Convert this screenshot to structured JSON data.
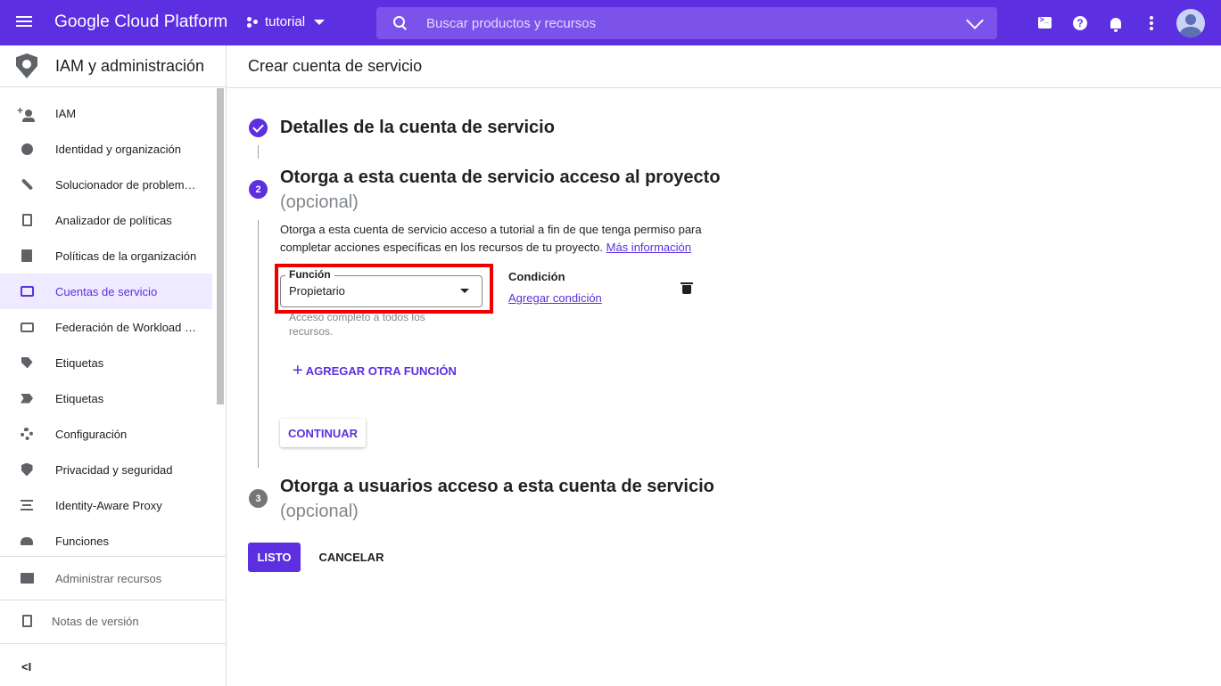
{
  "topbar": {
    "brand": "Google Cloud Platform",
    "project": "tutorial",
    "search_placeholder": "Buscar productos y recursos",
    "accent_color": "#5c2fe0",
    "icons": [
      "menu-icon",
      "project-icon",
      "search-icon",
      "chevron-down-icon",
      "cloud-shell-icon",
      "help-icon",
      "notifications-icon",
      "more-vert-icon",
      "account-avatar"
    ]
  },
  "sidebar": {
    "title": "IAM y administración",
    "items": [
      {
        "label": "IAM",
        "icon": "person-add-icon"
      },
      {
        "label": "Identidad y organización",
        "icon": "account-circle-icon"
      },
      {
        "label": "Solucionador de problem…",
        "icon": "wrench-icon"
      },
      {
        "label": "Analizador de políticas",
        "icon": "policy-doc-icon"
      },
      {
        "label": "Políticas de la organización",
        "icon": "list-doc-icon"
      },
      {
        "label": "Cuentas de servicio",
        "icon": "service-account-icon",
        "active": true
      },
      {
        "label": "Federación de Workload I…",
        "icon": "id-card-icon"
      },
      {
        "label": "Etiquetas",
        "icon": "tag-icon"
      },
      {
        "label": "Etiquetas",
        "icon": "label-icon"
      },
      {
        "label": "Configuración",
        "icon": "gear-icon"
      },
      {
        "label": "Privacidad y seguridad",
        "icon": "shield-icon"
      },
      {
        "label": "Identity-Aware Proxy",
        "icon": "proxy-icon"
      },
      {
        "label": "Funciones",
        "icon": "hat-icon"
      }
    ],
    "manage_resources": "Administrar recursos",
    "release_notes": "Notas de versión",
    "collapse": "<I"
  },
  "main": {
    "page_title": "Crear cuenta de servicio",
    "step1": {
      "title": "Detalles de la cuenta de servicio"
    },
    "step2": {
      "number": "2",
      "title": "Otorga a esta cuenta de servicio acceso al proyecto",
      "optional": "(opcional)",
      "description": "Otorga a esta cuenta de servicio acceso a tutorial a fin de que tenga permiso para completar acciones específicas en los recursos de tu proyecto.",
      "more_info": "Más información",
      "role_label": "Función",
      "role_value": "Propietario",
      "role_helper": "Acceso completo a todos los recursos.",
      "condition_label": "Condición",
      "add_condition": "Agregar condición",
      "add_role": "AGREGAR OTRA FUNCIÓN",
      "continue": "CONTINUAR"
    },
    "step3": {
      "number": "3",
      "title": "Otorga a usuarios acceso a esta cuenta de servicio",
      "optional": "(opcional)"
    },
    "done": "LISTO",
    "cancel": "CANCELAR"
  }
}
